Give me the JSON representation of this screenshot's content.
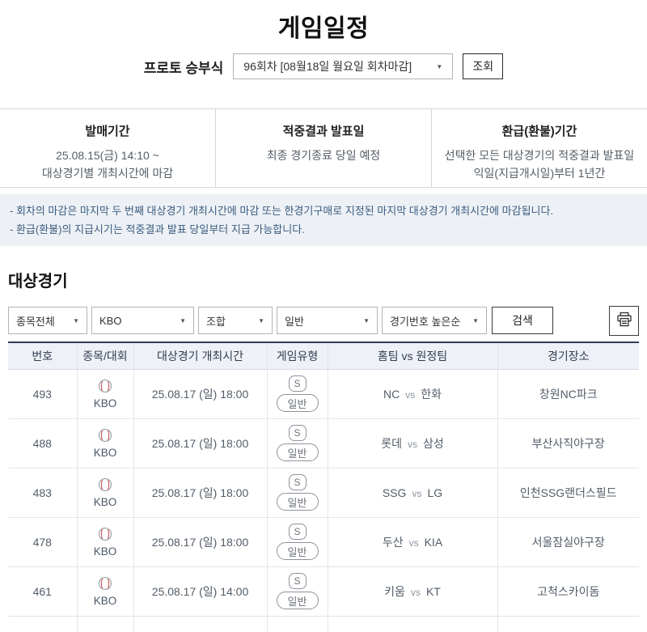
{
  "page_title": "게임일정",
  "proto": {
    "label": "프로토 승부식",
    "round": "96회차 [08월18일 월요일 회차마감]",
    "inquiry_button": "조회"
  },
  "info_panels": [
    {
      "title": "발매기간",
      "line1": "25.08.15(금) 14:10 ~",
      "line2": "대상경기별 개최시간에 마감"
    },
    {
      "title": "적중결과 발표일",
      "line1": "최종 경기종료 당일 예정",
      "line2": ""
    },
    {
      "title": "환급(환불)기간",
      "line1": "선택한 모든 대상경기의 적중결과 발표일",
      "line2": "익일(지급개시일)부터 1년간"
    }
  ],
  "notes": [
    "- 회차의 마감은 마지막 두 번째 대상경기 개최시간에 마감 또는 한경기구매로 지정된 마지막 대상경기 개최시간에 마감됩니다.",
    "- 환급(환불)의 지급시기는 적중결과 발표 당일부터 지급 가능합니다."
  ],
  "section_title": "대상경기",
  "filters": {
    "sport": "종목전체",
    "league": "KBO",
    "combo": "조합",
    "game_type": "일반",
    "sort": "경기번호 높은순",
    "search_button": "검색"
  },
  "table": {
    "headers": [
      "번호",
      "종목/대회",
      "대상경기 개최시간",
      "게임유형",
      "홈팀 vs 원정팀",
      "경기장소"
    ],
    "vs_label": "vs",
    "type_code": "S",
    "type_label": "일반",
    "rows": [
      {
        "no": "493",
        "league": "KBO",
        "time": "25.08.17 (일) 18:00",
        "home": "NC",
        "away": "한화",
        "venue": "창원NC파크"
      },
      {
        "no": "488",
        "league": "KBO",
        "time": "25.08.17 (일) 18:00",
        "home": "롯데",
        "away": "삼성",
        "venue": "부산사직야구장"
      },
      {
        "no": "483",
        "league": "KBO",
        "time": "25.08.17 (일) 18:00",
        "home": "SSG",
        "away": "LG",
        "venue": "인천SSG랜더스필드"
      },
      {
        "no": "478",
        "league": "KBO",
        "time": "25.08.17 (일) 18:00",
        "home": "두산",
        "away": "KIA",
        "venue": "서울잠실야구장"
      },
      {
        "no": "461",
        "league": "KBO",
        "time": "25.08.17 (일) 14:00",
        "home": "키움",
        "away": "KT",
        "venue": "고척스카이돔"
      }
    ]
  },
  "colors": {
    "table_top_border": "#2d3e5c",
    "header_bg": "#eef1f7",
    "notes_bg": "#edf1f6",
    "notes_text": "#3a5b7e",
    "baseball_stitch_red": "#cf5454"
  }
}
